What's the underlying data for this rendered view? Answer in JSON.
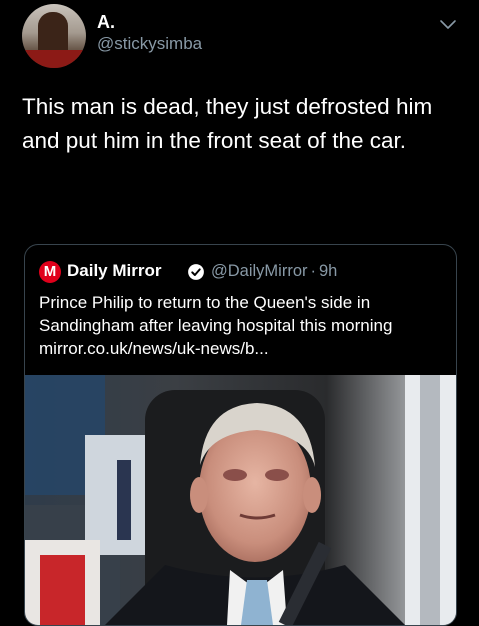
{
  "tweet": {
    "display_name": "A.",
    "handle": "@stickysimba",
    "text": "This man is dead, they just defrosted him and put him in the front seat of the car.",
    "avatar_icon": "profile-photo",
    "menu_icon": "chevron-down-icon"
  },
  "quote": {
    "logo_letter": "M",
    "name": "Daily Mirror",
    "handle": "@DailyMirror",
    "separator": "·",
    "time": "9h",
    "text": "Prince Philip to return to the Queen's side in Sandingham after leaving hospital this morning mirror.co.uk/news/uk-news/b...",
    "verified_icon": "verified-badge-icon",
    "brand_color": "#e0001b"
  },
  "colors": {
    "background": "#000000",
    "text": "#ffffff",
    "secondary_text": "#8899a6",
    "border": "#38444d"
  }
}
